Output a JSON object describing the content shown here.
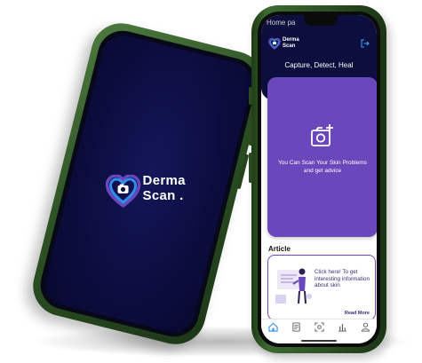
{
  "splash": {
    "brand_line1": "Derma",
    "brand_line2": "Scan ."
  },
  "home": {
    "tab_title": "Home pa",
    "header": {
      "brand_line1": "Derma",
      "brand_line2": "Scan",
      "tagline": "Capture, Detect, Heal",
      "logout_icon": "logout-icon"
    },
    "scan_card": {
      "icon": "camera-plus-icon",
      "text": "You Can Scan Your Skin Problems and get advice"
    },
    "article": {
      "section_title": "Article",
      "card_text": "Click here! To get interesting information about skin",
      "read_more": "Read More"
    },
    "nav": [
      {
        "icon": "home-icon",
        "label": ""
      },
      {
        "icon": "article-icon",
        "label": ""
      },
      {
        "icon": "scan-icon",
        "label": ""
      },
      {
        "icon": "history-icon",
        "label": ""
      },
      {
        "icon": "profile-icon",
        "label": ""
      }
    ]
  },
  "colors": {
    "splash_bg": "#0c0d3e",
    "header_bg": "#0c0e3e",
    "accent_purple": "#6a48bc",
    "logo_blue": "#2f8ff0",
    "phone_green": "#2d5224"
  }
}
